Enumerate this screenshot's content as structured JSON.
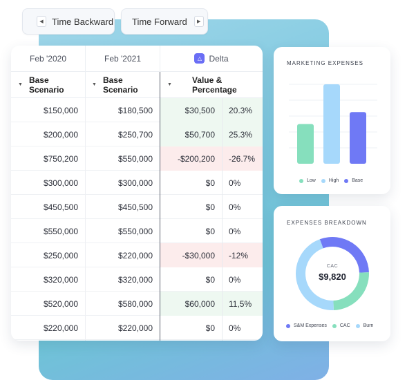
{
  "toolbar": {
    "back_label": "Time Backward",
    "forward_label": "Time Forward"
  },
  "table": {
    "periods": [
      "Feb '2020",
      "Feb '2021"
    ],
    "delta_label": "Delta",
    "scenarios": [
      "Base Scenario",
      "Base Scenario"
    ],
    "delta_subheader": "Value & Percentage",
    "rows": [
      {
        "a": "$150,000",
        "b": "$180,500",
        "delta": "$30,500",
        "pct": "20.3%",
        "trend": "pos"
      },
      {
        "a": "$200,000",
        "b": "$250,700",
        "delta": "$50,700",
        "pct": "25.3%",
        "trend": "pos"
      },
      {
        "a": "$750,200",
        "b": "$550,000",
        "delta": "-$200,200",
        "pct": "-26.7%",
        "trend": "neg"
      },
      {
        "a": "$300,000",
        "b": "$300,000",
        "delta": "$0",
        "pct": "0%",
        "trend": "none"
      },
      {
        "a": "$450,500",
        "b": "$450,500",
        "delta": "$0",
        "pct": "0%",
        "trend": "none"
      },
      {
        "a": "$550,000",
        "b": "$550,000",
        "delta": "$0",
        "pct": "0%",
        "trend": "none"
      },
      {
        "a": "$250,000",
        "b": "$220,000",
        "delta": "-$30,000",
        "pct": "-12%",
        "trend": "neg"
      },
      {
        "a": "$320,000",
        "b": "$320,000",
        "delta": "$0",
        "pct": "0%",
        "trend": "none"
      },
      {
        "a": "$520,000",
        "b": "$580,000",
        "delta": "$60,000",
        "pct": "11,5%",
        "trend": "pos"
      },
      {
        "a": "$220,000",
        "b": "$220,000",
        "delta": "$0",
        "pct": "0%",
        "trend": "none"
      }
    ]
  },
  "marketing": {
    "title": "MARKETING EXPENSES",
    "chart_data": {
      "type": "bar",
      "categories": [
        "Low",
        "High",
        "Base"
      ],
      "values": [
        50,
        100,
        65
      ],
      "colors": [
        "#86dfbd",
        "#a6d8fb",
        "#6f79f5"
      ],
      "ylim": [
        0,
        100
      ],
      "grid": true,
      "legend": "bottom"
    }
  },
  "breakdown": {
    "title": "EXPENSES BREAKDOWN",
    "center_label": "CAC",
    "center_value": "$9,820",
    "chart_data": {
      "type": "pie",
      "categories": [
        "S&M Expenses",
        "CAC",
        "Burn"
      ],
      "values": [
        30,
        25,
        45
      ],
      "colors": [
        "#6f79f5",
        "#86dfbd",
        "#a6d8fb"
      ],
      "legend": "bottom"
    }
  },
  "icons": {
    "back": "chevron-left-icon",
    "forward": "chevron-right-icon",
    "sort": "caret-down-icon",
    "delta": "delta-icon"
  }
}
